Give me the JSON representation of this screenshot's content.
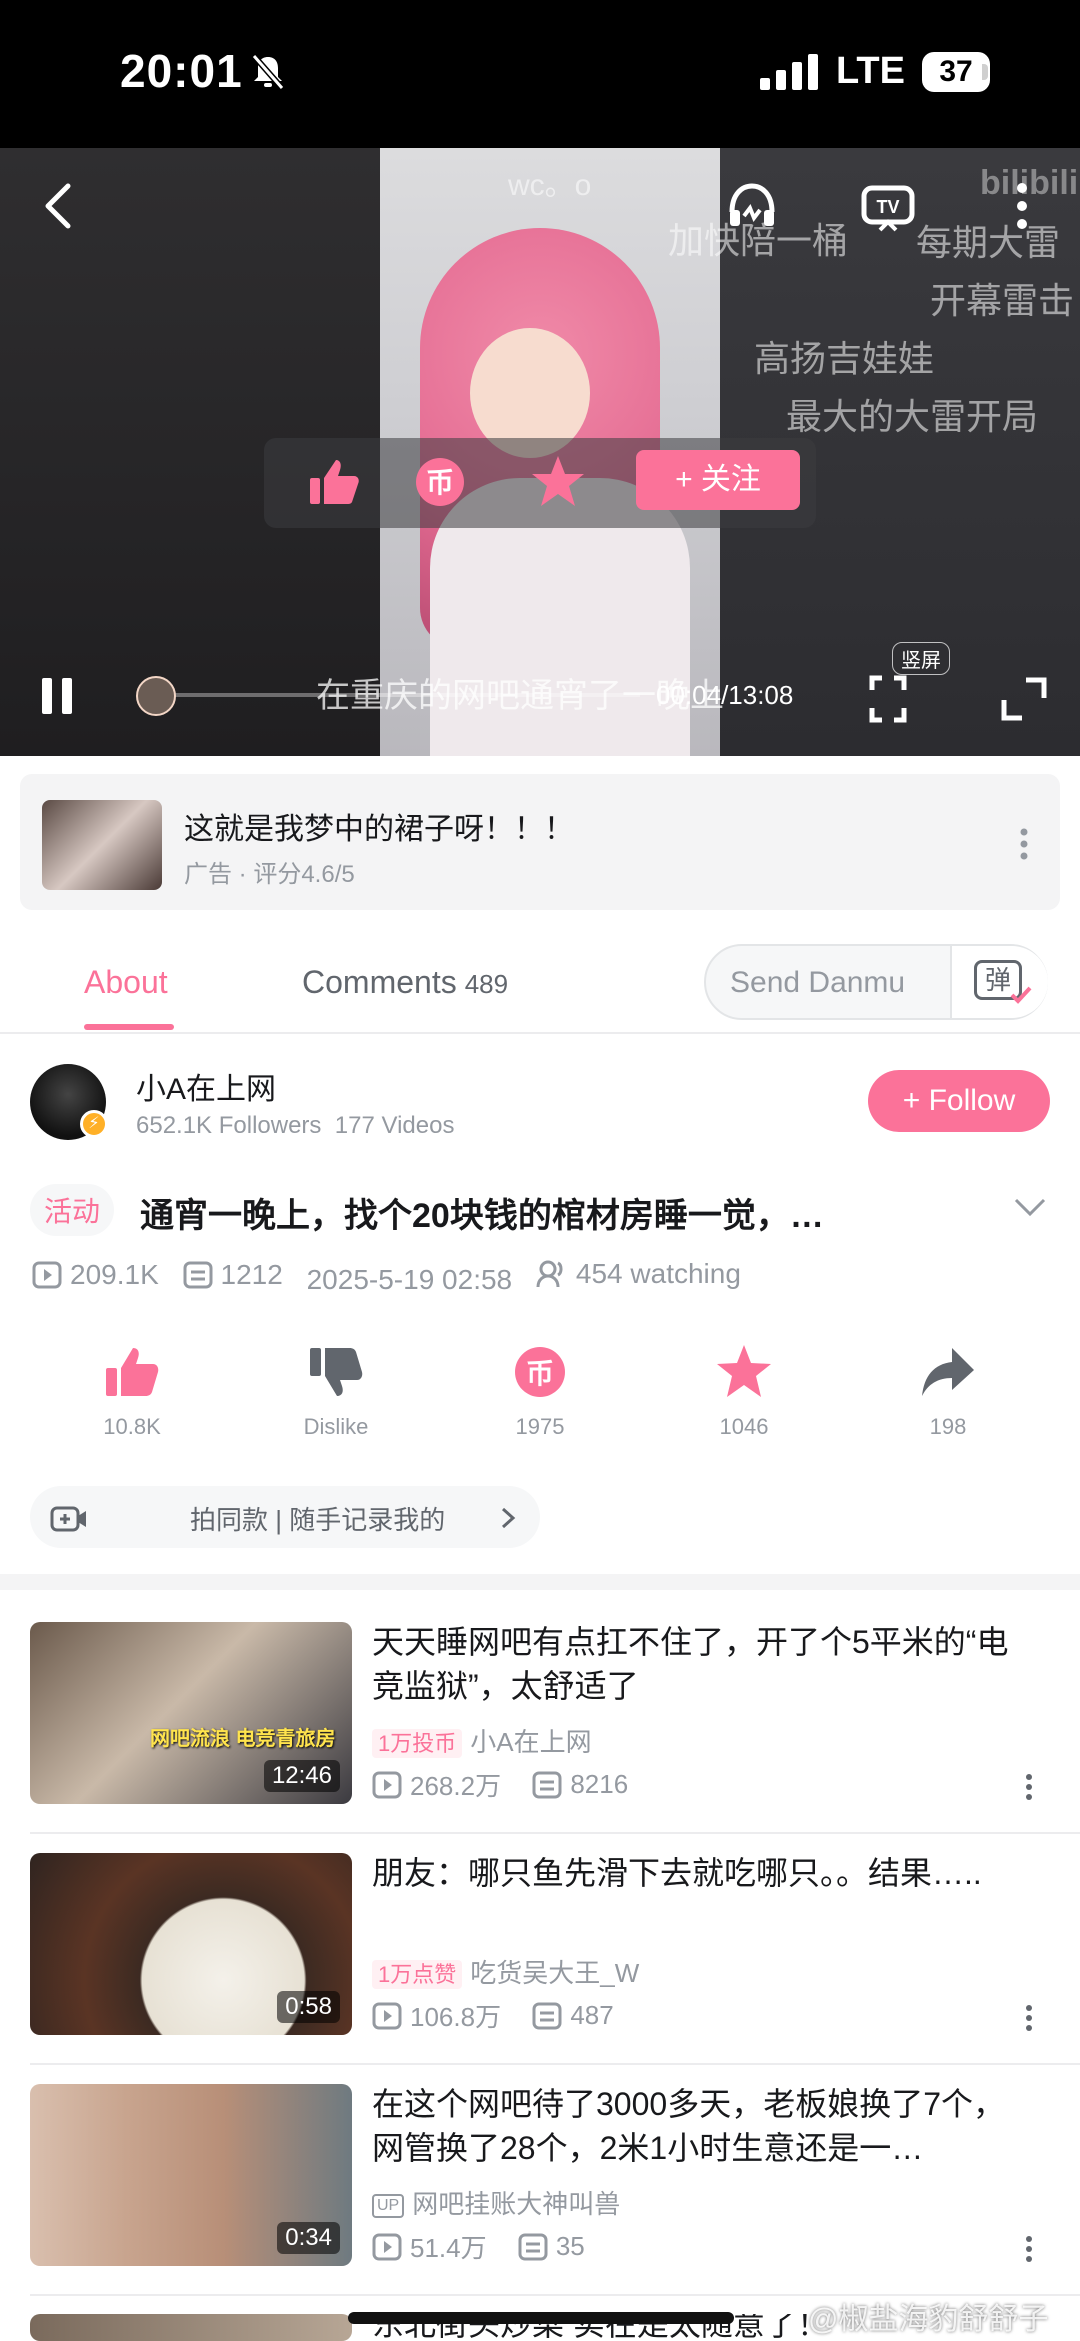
{
  "status_bar": {
    "time": "20:01",
    "network": "LTE",
    "battery": "37"
  },
  "player": {
    "danmaku": [
      "wc。o",
      "加快陪一桶",
      "每期大雷",
      "开幕雷击",
      "高扬吉娃娃",
      "最大的大雷开局"
    ],
    "follow_label": "+ 关注",
    "subtitle": "在重庆的网吧通宵了一晚上",
    "time": "00:04/13:08",
    "portrait_label": "竖屏",
    "logo": "bilibili"
  },
  "ad": {
    "title": "这就是我梦中的裙子呀！！！",
    "subtitle": "广告 · 评分4.6/5"
  },
  "tabs": {
    "about": "About",
    "comments": "Comments",
    "comments_count": "489",
    "danmu_placeholder": "Send Danmu",
    "danmu_toggle": "弹"
  },
  "uploader": {
    "name": "小A在上网",
    "followers": "652.1K Followers",
    "videos": "177 Videos",
    "follow_label": "+ Follow"
  },
  "video": {
    "tag": "活动",
    "title": "通宵一晚上，找个20块钱的棺材房睡一觉，…",
    "views": "209.1K",
    "danmaku_count": "1212",
    "date": "2025-5-19 02:58",
    "watching": "454 watching"
  },
  "actions": [
    {
      "icon": "thumbs-up-icon",
      "label": "10.8K"
    },
    {
      "icon": "thumbs-down-icon",
      "label": "Dislike"
    },
    {
      "icon": "coin-icon",
      "label": "1975"
    },
    {
      "icon": "star-icon",
      "label": "1046"
    },
    {
      "icon": "share-icon",
      "label": "198"
    }
  ],
  "ugc": {
    "label": "拍同款 | 随手记录我的"
  },
  "recommendations": [
    {
      "title": "天天睡网吧有点扛不住了，开了个5平米的“电竞监狱”，太舒适了",
      "duration": "12:46",
      "badge": "1万投币",
      "author": "小A在上网",
      "views": "268.2万",
      "danmaku": "8216",
      "thumb_text": "网吧流浪 电竞青旅房"
    },
    {
      "title": "朋友：哪只鱼先滑下去就吃哪只。。结果…..",
      "duration": "0:58",
      "badge": "1万点赞",
      "author": "吃货吴大王_W",
      "views": "106.8万",
      "danmaku": "487"
    },
    {
      "title": "在这个网吧待了3000多天，老板娘换了7个，网管换了28个，2米1小时生意还是一…",
      "duration": "0:34",
      "up_tag": "UP",
      "author": "网吧挂账大神叫兽",
      "views": "51.4万",
      "danmaku": "35"
    },
    {
      "title": "东北街头炒菜 实在是太随意了！"
    }
  ],
  "watermark": "@椒盐海豹舒舒子",
  "colors": {
    "accent": "#fb7299",
    "text_primary": "#18191c",
    "text_secondary": "#9499a0"
  }
}
